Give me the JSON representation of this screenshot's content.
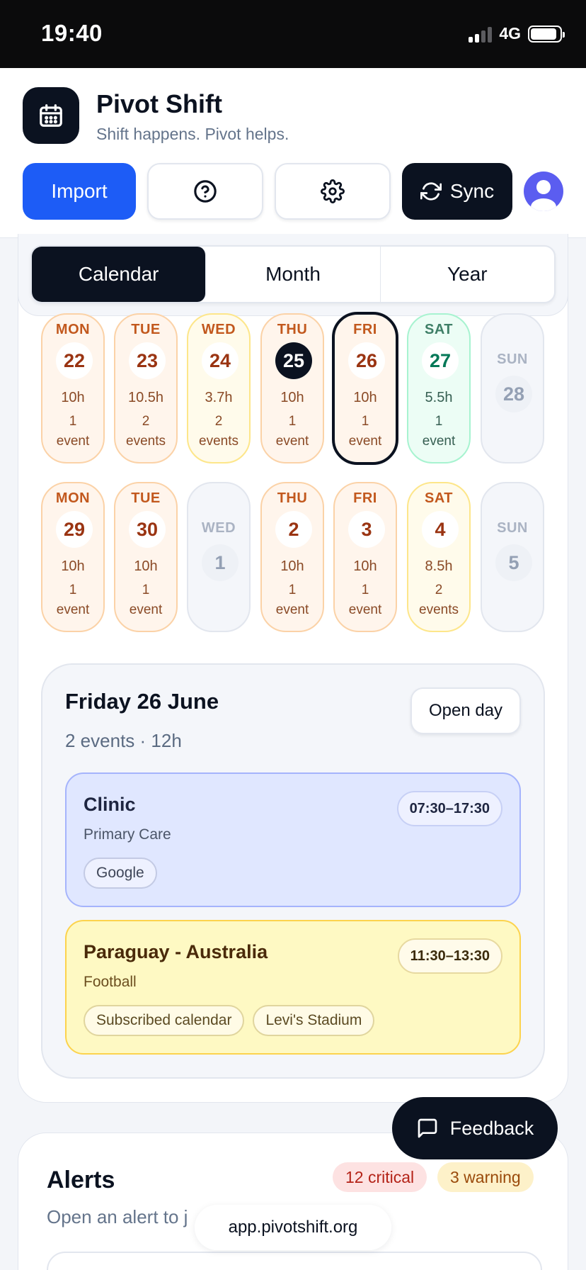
{
  "status_bar": {
    "time": "19:40",
    "network": "4G"
  },
  "header": {
    "app_title": "Pivot Shift",
    "app_subtitle": "Shift happens. Pivot helps.",
    "toolbar": {
      "import_label": "Import",
      "sync_label": "Sync"
    }
  },
  "view_tabs": [
    {
      "label": "Calendar",
      "active": true
    },
    {
      "label": "Month",
      "active": false
    },
    {
      "label": "Year",
      "active": false
    }
  ],
  "weeks": [
    [
      {
        "dow": "MON",
        "num": "22",
        "hours": "10h",
        "count": "1",
        "unit": "event",
        "tone": "orange"
      },
      {
        "dow": "TUE",
        "num": "23",
        "hours": "10.5h",
        "count": "2",
        "unit": "events",
        "tone": "orange"
      },
      {
        "dow": "WED",
        "num": "24",
        "hours": "3.7h",
        "count": "2",
        "unit": "events",
        "tone": "amber"
      },
      {
        "dow": "THU",
        "num": "25",
        "hours": "10h",
        "count": "1",
        "unit": "event",
        "tone": "orange",
        "today": true
      },
      {
        "dow": "FRI",
        "num": "26",
        "hours": "10h",
        "count": "1",
        "unit": "event",
        "tone": "orange",
        "selected": true
      },
      {
        "dow": "SAT",
        "num": "27",
        "hours": "5.5h",
        "count": "1",
        "unit": "event",
        "tone": "green"
      },
      {
        "dow": "SUN",
        "num": "28",
        "tone": "empty"
      }
    ],
    [
      {
        "dow": "MON",
        "num": "29",
        "hours": "10h",
        "count": "1",
        "unit": "event",
        "tone": "orange"
      },
      {
        "dow": "TUE",
        "num": "30",
        "hours": "10h",
        "count": "1",
        "unit": "event",
        "tone": "orange"
      },
      {
        "dow": "WED",
        "num": "1",
        "tone": "empty"
      },
      {
        "dow": "THU",
        "num": "2",
        "hours": "10h",
        "count": "1",
        "unit": "event",
        "tone": "orange"
      },
      {
        "dow": "FRI",
        "num": "3",
        "hours": "10h",
        "count": "1",
        "unit": "event",
        "tone": "orange"
      },
      {
        "dow": "SAT",
        "num": "4",
        "hours": "8.5h",
        "count": "2",
        "unit": "events",
        "tone": "amber"
      },
      {
        "dow": "SUN",
        "num": "5",
        "tone": "empty"
      }
    ]
  ],
  "day_detail": {
    "title": "Friday 26 June",
    "subtitle": "2 events · 12h",
    "open_label": "Open day",
    "events": [
      {
        "title": "Clinic",
        "subtitle": "Primary Care",
        "time": "07:30–17:30",
        "chips": [
          "Google"
        ],
        "color": "#e0e7ff"
      },
      {
        "title": "Paraguay - Australia",
        "subtitle": "Football",
        "time": "11:30–13:30",
        "chips": [
          "Subscribed calendar",
          "Levi's Stadium"
        ],
        "color": "#fef9c3"
      }
    ]
  },
  "feedback_label": "Feedback",
  "alerts": {
    "title": "Alerts",
    "subtitle": "Open an alert to j",
    "critical": "12 critical",
    "warning": "3 warning"
  },
  "browser": {
    "url": "app.pivotshift.org"
  },
  "colors": {
    "accent": "#1d5cf6",
    "dark": "#0b1220",
    "avatar": "#5b5df0"
  },
  "icons": {
    "logo": "calendar-icon",
    "help": "question-circle-icon",
    "settings": "gear-icon",
    "sync": "refresh-icon",
    "feedback": "message-square-icon"
  }
}
